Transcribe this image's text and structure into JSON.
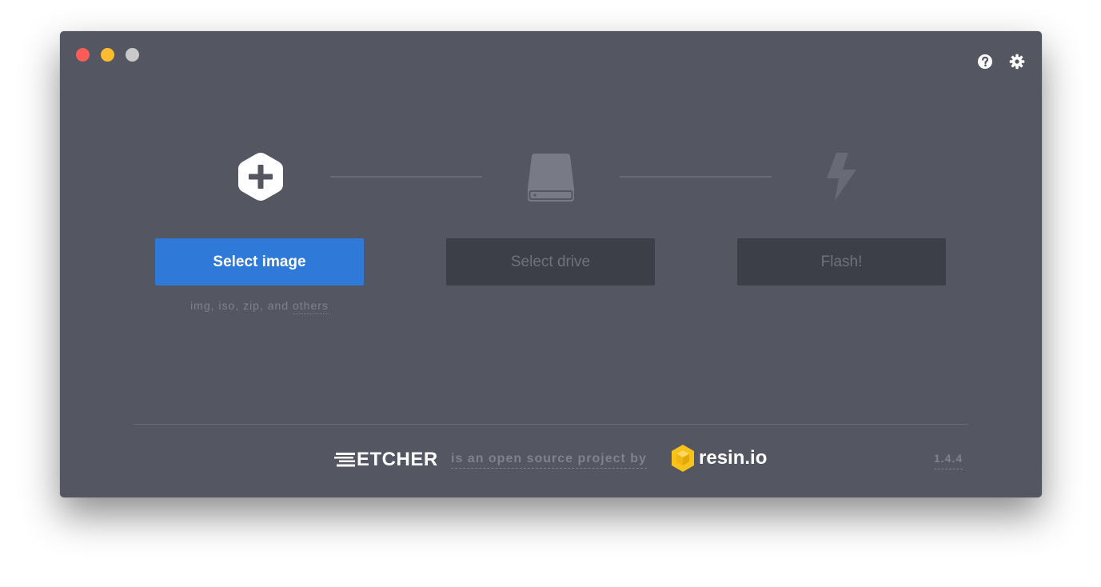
{
  "window": {
    "controls": [
      "close",
      "minimize",
      "maximize"
    ]
  },
  "toolbar": {
    "help_icon": "help-icon",
    "settings_icon": "gear-icon"
  },
  "steps": {
    "image": {
      "icon": "plus-hexagon-icon",
      "button_label": "Select image",
      "formats_prefix": "img, iso, zip, and ",
      "formats_link": "others"
    },
    "drive": {
      "icon": "drive-icon",
      "button_label": "Select drive"
    },
    "flash": {
      "icon": "lightning-icon",
      "button_label": "Flash!"
    }
  },
  "footer": {
    "etcher_logo_text": "ETCHER",
    "tagline": "is an open source project by",
    "resin_logo_text": "resin.io",
    "version": "1.4.4"
  },
  "colors": {
    "window_bg": "#545761",
    "primary": "#2f79d9",
    "disabled_bg": "#3d3f48",
    "disabled_text": "#6f727c",
    "muted_text": "#7f828b",
    "resin_yellow": "#f7c21a"
  }
}
